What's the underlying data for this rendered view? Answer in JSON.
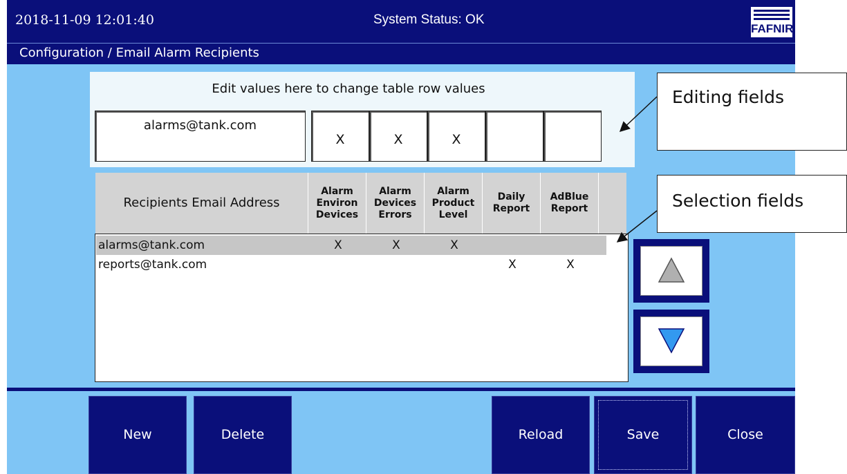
{
  "header": {
    "datetime": "2018-11-09  12:01:40",
    "status": "System Status: OK",
    "logo_text": "FAFNIR"
  },
  "breadcrumb": "Configuration / Email Alarm Recipients",
  "edit_panel": {
    "title": "Edit values here  to change table row values",
    "email": "alarms@tank.com",
    "cols": [
      "X",
      "X",
      "X",
      "",
      ""
    ]
  },
  "table": {
    "headers": {
      "email": "Recipients Email Address",
      "cols": [
        [
          "Alarm",
          "Environ",
          "Devices"
        ],
        [
          "Alarm",
          "Devices",
          "Errors"
        ],
        [
          "Alarm",
          "Product",
          "Level"
        ],
        [
          "Daily",
          "Report"
        ],
        [
          "AdBlue",
          "Report"
        ]
      ]
    },
    "rows": [
      {
        "email": "alarms@tank.com",
        "cols": [
          "X",
          "X",
          "X",
          "",
          ""
        ],
        "selected": true
      },
      {
        "email": "reports@tank.com",
        "cols": [
          "",
          "",
          "",
          "X",
          "X"
        ],
        "selected": false
      }
    ]
  },
  "nav": {
    "up_icon": "triangle-up-icon",
    "down_icon": "triangle-down-icon"
  },
  "footer": {
    "new": "New",
    "delete": "Delete",
    "reload": "Reload",
    "save": "Save",
    "close": "Close"
  },
  "annotations": {
    "editing": "Editing fields",
    "selection": "Selection fields"
  },
  "colors": {
    "bar": "#0a0f7a",
    "background": "#7fc5f5",
    "selected_row": "#c6c6c6",
    "down_arrow": "#3399f0",
    "up_arrow": "#b0b0b0"
  }
}
